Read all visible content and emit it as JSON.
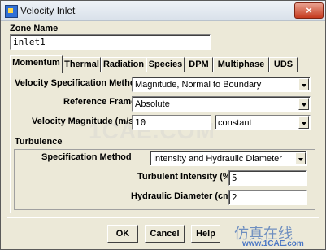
{
  "window": {
    "title": "Velocity Inlet",
    "close_glyph": "×"
  },
  "zone": {
    "label": "Zone Name",
    "value": "inlet1"
  },
  "tabs": [
    {
      "label": "Momentum",
      "active": true
    },
    {
      "label": "Thermal"
    },
    {
      "label": "Radiation"
    },
    {
      "label": "Species"
    },
    {
      "label": "DPM"
    },
    {
      "label": "Multiphase"
    },
    {
      "label": "UDS"
    }
  ],
  "momentum": {
    "velocity_spec_method": {
      "label": "Velocity Specification Method",
      "value": "Magnitude, Normal to Boundary"
    },
    "reference_frame": {
      "label": "Reference Frame",
      "value": "Absolute"
    },
    "velocity_magnitude": {
      "label": "Velocity Magnitude (m/s)",
      "value": "10",
      "profile": "constant"
    }
  },
  "turbulence": {
    "section_label": "Turbulence",
    "spec_method": {
      "label": "Specification Method",
      "value": "Intensity and Hydraulic Diameter"
    },
    "intensity": {
      "label": "Turbulent Intensity (%)",
      "value": "5"
    },
    "hydraulic_diameter": {
      "label": "Hydraulic Diameter (cm)",
      "value": "2"
    }
  },
  "buttons": {
    "ok": "OK",
    "cancel": "Cancel",
    "help": "Help"
  },
  "watermark": {
    "center": "1CAE.COM",
    "logo_cn": "仿真在线",
    "logo_url": "www.1CAE.com"
  }
}
